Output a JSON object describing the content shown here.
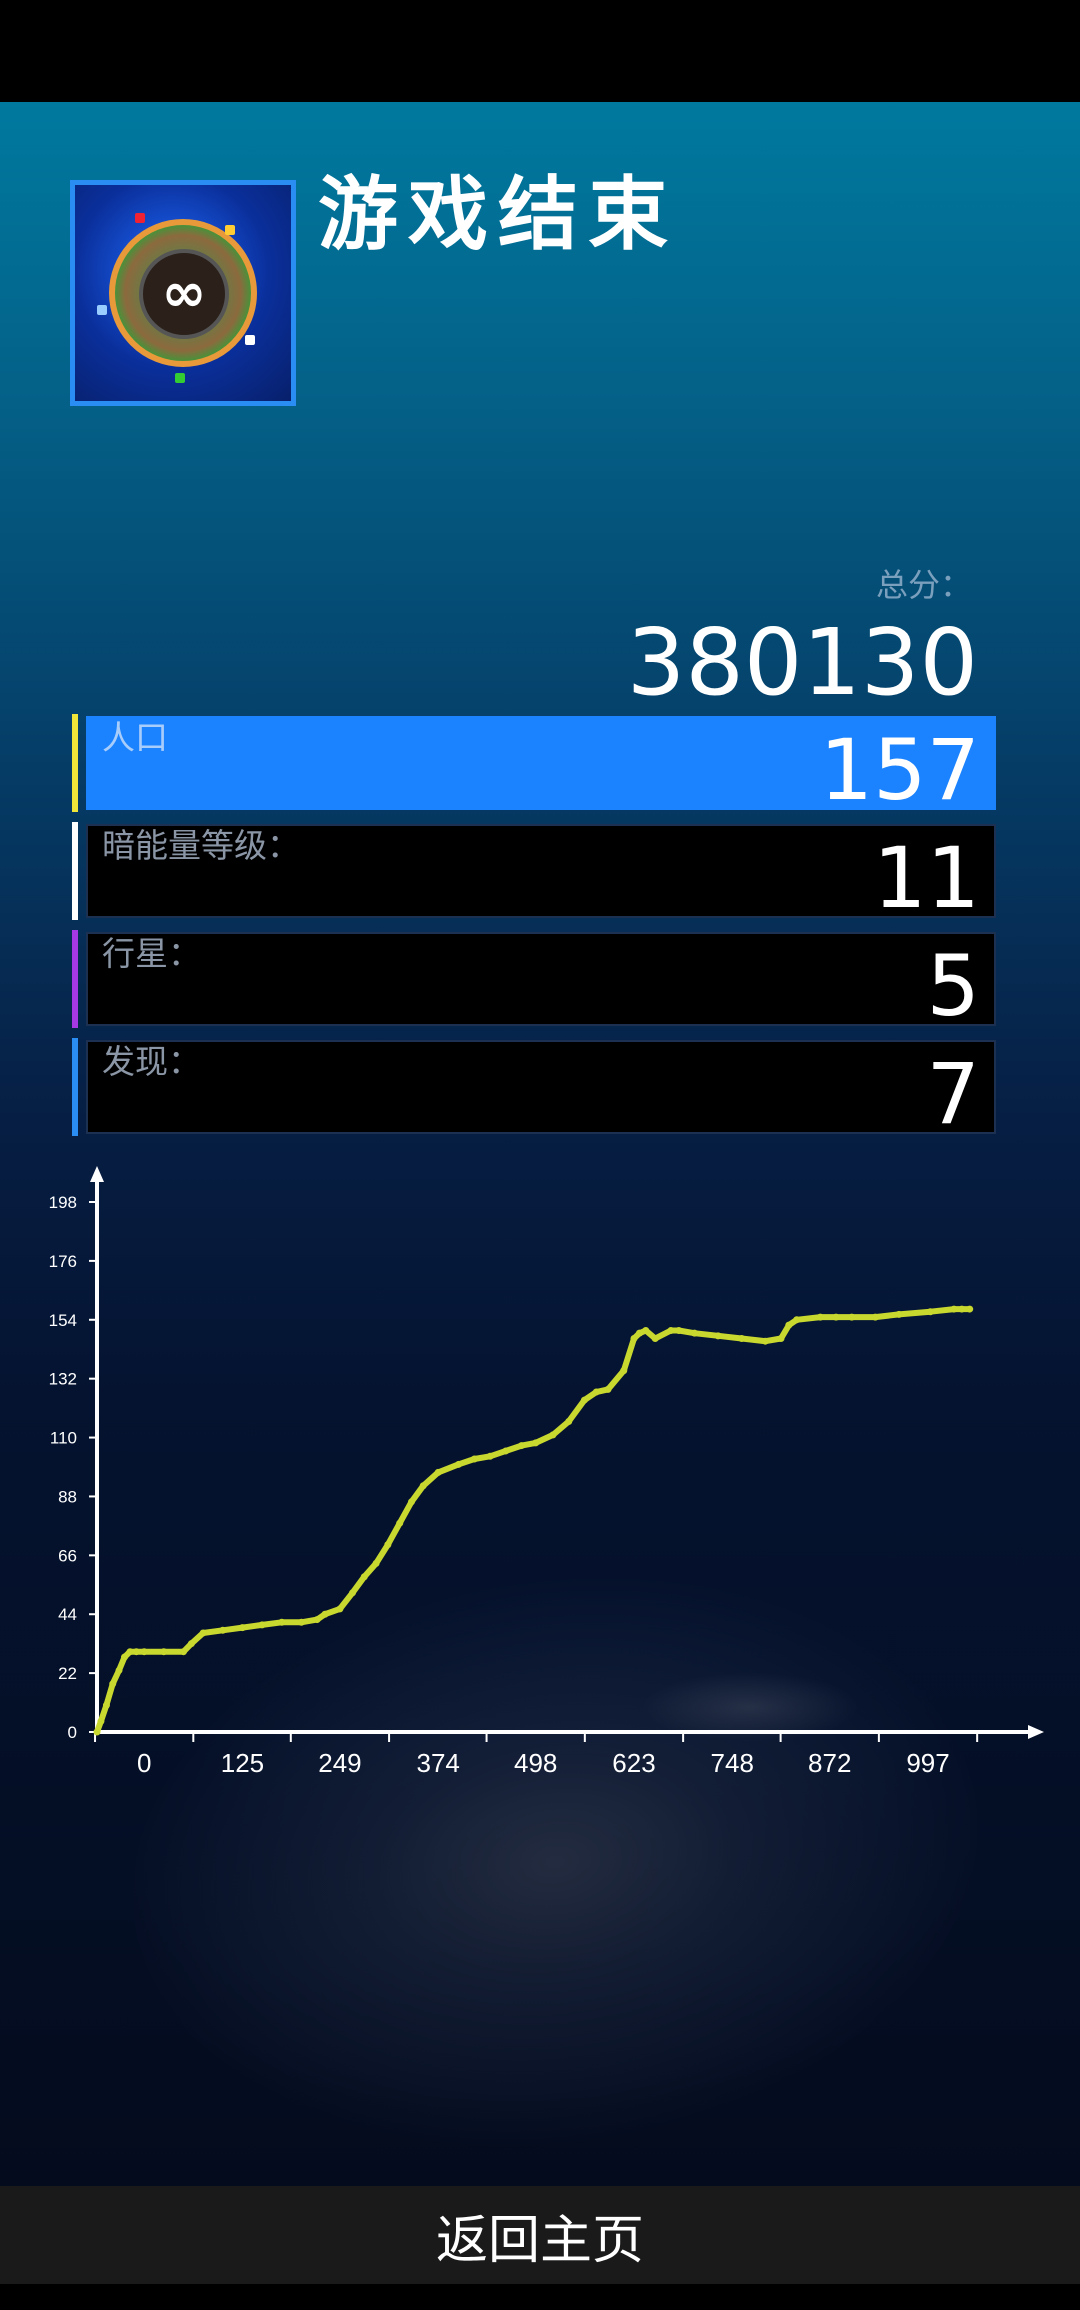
{
  "title": "游戏结束",
  "total": {
    "label": "总分：",
    "value": "380130"
  },
  "stats": [
    {
      "label": "人口",
      "value": "157",
      "accent": "#f0e63a",
      "active": true
    },
    {
      "label": "暗能量等级：",
      "value": "11",
      "accent": "#ffffff",
      "active": false
    },
    {
      "label": "行星：",
      "value": "5",
      "accent": "#a638e6",
      "active": false
    },
    {
      "label": "发现：",
      "value": "7",
      "accent": "#2a8df3",
      "active": false
    }
  ],
  "bottom_button": {
    "label": "返回主页"
  },
  "colors": {
    "line": "#c8d82e",
    "highlight": "#1b83ff"
  },
  "chart_data": {
    "type": "line",
    "title": "",
    "xlabel": "",
    "ylabel": "",
    "x_ticks": [
      "0",
      "125",
      "249",
      "374",
      "498",
      "623",
      "748",
      "872",
      "997"
    ],
    "y_ticks": [
      "0",
      "22",
      "44",
      "66",
      "88",
      "110",
      "132",
      "154",
      "176",
      "198"
    ],
    "xlim": [
      -60,
      1100
    ],
    "ylim": [
      0,
      198
    ],
    "series": [
      {
        "name": "",
        "x": [
          -60,
          -55,
          -48,
          -40,
          -32,
          -25,
          -18,
          -10,
          0,
          25,
          50,
          60,
          75,
          100,
          125,
          150,
          175,
          200,
          220,
          230,
          249,
          265,
          280,
          295,
          310,
          325,
          340,
          355,
          374,
          400,
          420,
          440,
          460,
          480,
          498,
          520,
          540,
          560,
          575,
          590,
          610,
          623,
          630,
          638,
          650,
          670,
          680,
          700,
          730,
          760,
          790,
          810,
          820,
          830,
          860,
          880,
          900,
          930,
          960,
          1000,
          1030,
          1040,
          1050
        ],
        "y": [
          0,
          4,
          10,
          18,
          23,
          28,
          30,
          30,
          30,
          30,
          30,
          33,
          37,
          38,
          39,
          40,
          41,
          41,
          42,
          44,
          46,
          52,
          58,
          63,
          70,
          78,
          86,
          92,
          97,
          100,
          102,
          103,
          105,
          107,
          108,
          111,
          116,
          124,
          127,
          128,
          135,
          147,
          149,
          150,
          147,
          150,
          150,
          149,
          148,
          147,
          146,
          147,
          152,
          154,
          155,
          155,
          155,
          155,
          156,
          157,
          158,
          158,
          158
        ]
      }
    ]
  }
}
